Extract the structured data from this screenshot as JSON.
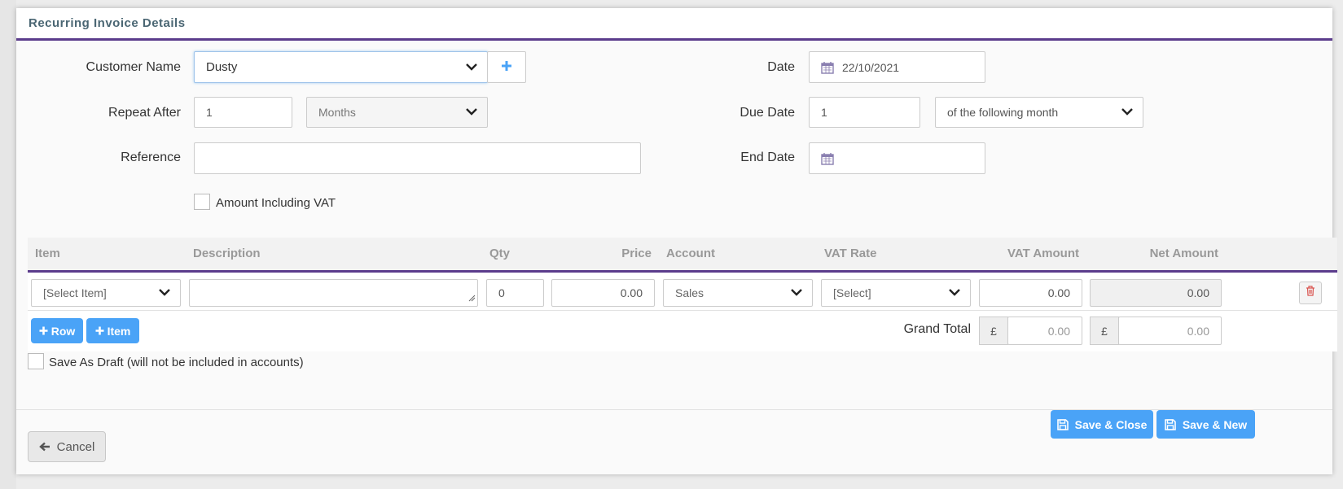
{
  "modal": {
    "title": "Recurring Invoice Details"
  },
  "form": {
    "customer_name_label": "Customer Name",
    "customer_name_value": "Dusty",
    "add_customer_icon": "plus-icon",
    "repeat_after_label": "Repeat After",
    "repeat_after_value": "1",
    "repeat_period_value": "Months",
    "reference_label": "Reference",
    "reference_value": "",
    "amount_including_vat_label": "Amount Including VAT",
    "date_label": "Date",
    "date_value": "22/10/2021",
    "due_date_label": "Due Date",
    "due_date_value": "1",
    "due_date_term_value": "of the following month",
    "end_date_label": "End Date",
    "end_date_value": ""
  },
  "table": {
    "headers": [
      "Item",
      "Description",
      "Qty",
      "Price",
      "Account",
      "VAT Rate",
      "VAT Amount",
      "Net Amount"
    ],
    "row": {
      "item": "[Select Item]",
      "description": "",
      "qty": "0",
      "price": "0.00",
      "account": "Sales",
      "vat_rate": "[Select]",
      "vat_amount": "0.00",
      "net_amount": "0.00"
    },
    "add_row_label": "Row",
    "add_item_label": "Item",
    "grand_total_label": "Grand Total",
    "currency_symbol": "£",
    "grand_total_vat": "0.00",
    "grand_total_net": "0.00"
  },
  "save_as_draft_label": "Save As Draft (will not be included in accounts)",
  "footer": {
    "cancel_label": "Cancel",
    "save_close_label": "Save & Close",
    "save_new_label": "Save & New"
  },
  "colors": {
    "accent": "#5b3c8c",
    "primary_button": "#4aa3f7",
    "title": "#4a6673"
  }
}
